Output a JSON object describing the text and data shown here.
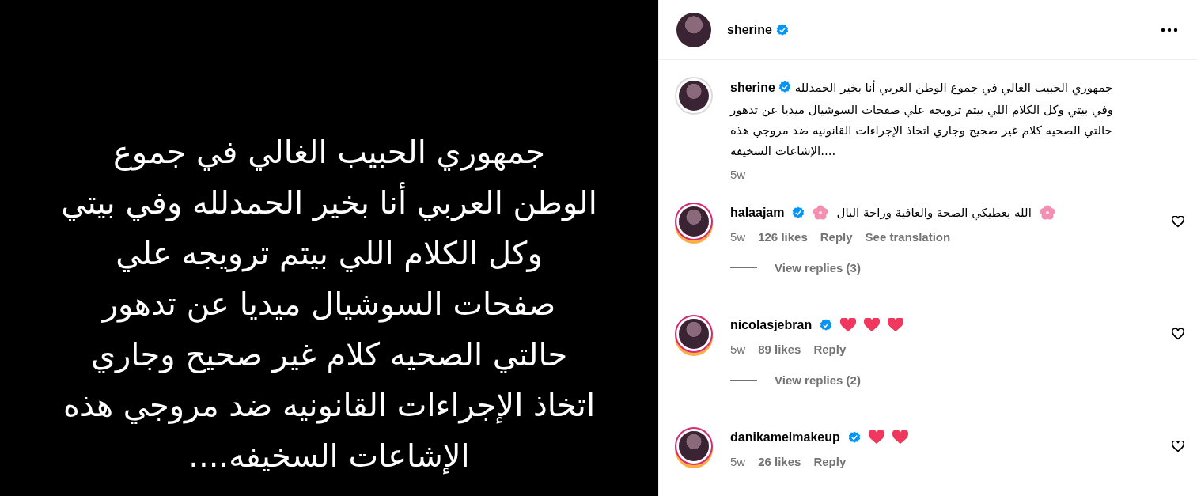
{
  "post_image": {
    "lines": [
      "جمهوري الحبيب الغالي في جموع",
      "الوطن العربي أنا بخير الحمدلله وفي بيتي",
      "وكل الكلام اللي بيتم ترويجه علي",
      "صفحات السوشيال ميديا عن تدهور",
      "حالتي الصحيه كلام غير صحيح وجاري",
      "اتخاذ الإجراءات القانونيه ضد مروجي هذه",
      "الإشاعات السخيفه...."
    ]
  },
  "header": {
    "username": "sherine",
    "verified": true
  },
  "caption": {
    "username": "sherine",
    "verified": true,
    "text": "جمهوري الحبيب الغالي في جموع الوطن العربي أنا بخير الحمدلله وفي بيتي وكل الكلام اللي بيتم ترويجه علي صفحات السوشيال ميديا عن تدهور حالتي الصحيه كلام غير صحيح وجاري اتخاذ الإجراءات القانونيه ضد مروجي هذه الإشاعات السخيفه....",
    "time": "5w"
  },
  "comments": [
    {
      "username": "halaajam",
      "verified": true,
      "parts": [
        {
          "kind": "flower"
        },
        {
          "kind": "text",
          "text": "الله يعطيكي الصحة والعافية وراحة البال"
        },
        {
          "kind": "flower"
        }
      ],
      "time": "5w",
      "likes": "126 likes",
      "reply": "Reply",
      "translate": "See translation",
      "view_replies": "View replies (3)"
    },
    {
      "username": "nicolasjebran",
      "verified": true,
      "parts": [
        {
          "kind": "heart"
        },
        {
          "kind": "heart"
        },
        {
          "kind": "heart"
        }
      ],
      "time": "5w",
      "likes": "89 likes",
      "reply": "Reply",
      "view_replies": "View replies (2)"
    },
    {
      "username": "danikamelmakeup",
      "verified": true,
      "parts": [
        {
          "kind": "heart"
        },
        {
          "kind": "heart"
        }
      ],
      "time": "5w",
      "likes": "26 likes",
      "reply": "Reply"
    }
  ]
}
